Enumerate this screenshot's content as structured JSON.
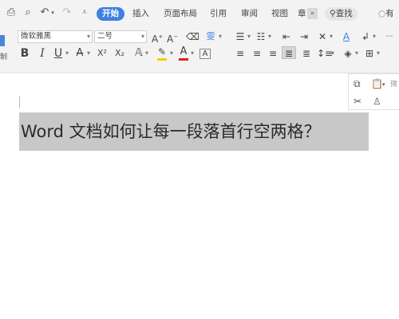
{
  "menu": {
    "tabs": [
      {
        "label": "开始",
        "active": true
      },
      {
        "label": "插入"
      },
      {
        "label": "页面布局"
      },
      {
        "label": "引用"
      },
      {
        "label": "审阅"
      },
      {
        "label": "视图"
      },
      {
        "label": "章"
      }
    ],
    "more": "»",
    "search_label": "查找",
    "right_cut": "有"
  },
  "toolbar": {
    "font_name": "微软雅黑",
    "font_size": "二号",
    "grow_font": "A",
    "shrink_font": "A",
    "bold": "B",
    "italic": "I",
    "underline": "U",
    "strike": "A",
    "superscript": "X²",
    "subscript": "X₂",
    "font_color": "A",
    "char_border": "A",
    "phonetic": "雯"
  },
  "mini_toolbar": {
    "right_cut": "微"
  },
  "document": {
    "text": "Word 文档如何让每一段落首行空两格？"
  },
  "colors": {
    "accent": "#3f7fe6",
    "selection": "#c8c8c8",
    "font_color_bar": "#e02020",
    "highlight_bar": "#f5d000",
    "left_marker": "#4a86d8"
  }
}
